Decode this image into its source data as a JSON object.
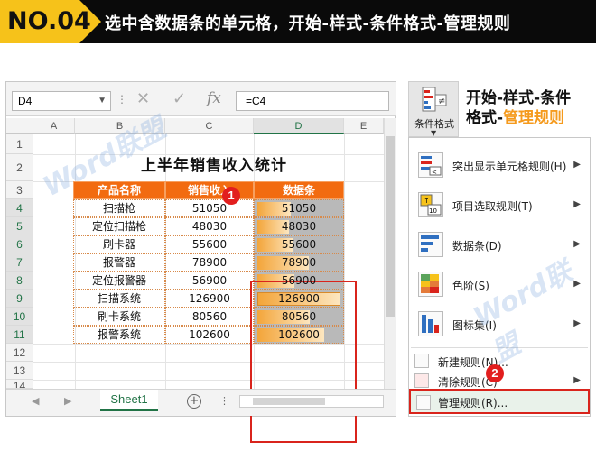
{
  "header": {
    "badge": "NO.04",
    "title": "选中含数据条的单元格，开始-样式-条件格式-管理规则"
  },
  "excel": {
    "name_box": "D4",
    "formula": "=C4",
    "fx_label": "fx",
    "columns": [
      "A",
      "B",
      "C",
      "D",
      "E"
    ],
    "rows": [
      "1",
      "2",
      "3",
      "4",
      "5",
      "6",
      "7",
      "8",
      "9",
      "10",
      "11",
      "12",
      "13",
      "14"
    ],
    "sheet_title": "上半年销售收入统计",
    "table_headers": [
      "产品名称",
      "销售收入",
      "数据条"
    ],
    "table_rows": [
      {
        "name": "扫描枪",
        "sales": "51050",
        "bar": "51050",
        "value": 51050
      },
      {
        "name": "定位扫描枪",
        "sales": "48030",
        "bar": "48030",
        "value": 48030
      },
      {
        "name": "刷卡器",
        "sales": "55600",
        "bar": "55600",
        "value": 55600
      },
      {
        "name": "报警器",
        "sales": "78900",
        "bar": "78900",
        "value": 78900
      },
      {
        "name": "定位报警器",
        "sales": "56900",
        "bar": "56900",
        "value": 56900
      },
      {
        "name": "扫描系统",
        "sales": "126900",
        "bar": "126900",
        "value": 126900
      },
      {
        "name": "刷卡系统",
        "sales": "80560",
        "bar": "80560",
        "value": 80560
      },
      {
        "name": "报警系统",
        "sales": "102600",
        "bar": "102600",
        "value": 102600
      }
    ],
    "sheet_tab": "Sheet1",
    "step1": "1"
  },
  "ribbon": {
    "cf_button": "条件格式",
    "hint_line1": "开始-样式-条件",
    "hint_line2a": "格式-",
    "hint_line2b": "管理规则"
  },
  "menu": {
    "items": [
      "突出显示单元格规则(H)",
      "项目选取规则(T)",
      "数据条(D)",
      "色阶(S)",
      "图标集(I)"
    ],
    "new_rule": "新建规则(N)...",
    "clear_rule": "清除规则(C)",
    "manage_rule": "管理规则(R)...",
    "step2": "2"
  },
  "watermarks": [
    "Word联盟",
    "Word联盟"
  ],
  "colors": {
    "accent_orange": "#f26b10",
    "excel_green": "#217346",
    "highlight_red": "#d9241c",
    "badge_yellow": "#f6c21a"
  }
}
